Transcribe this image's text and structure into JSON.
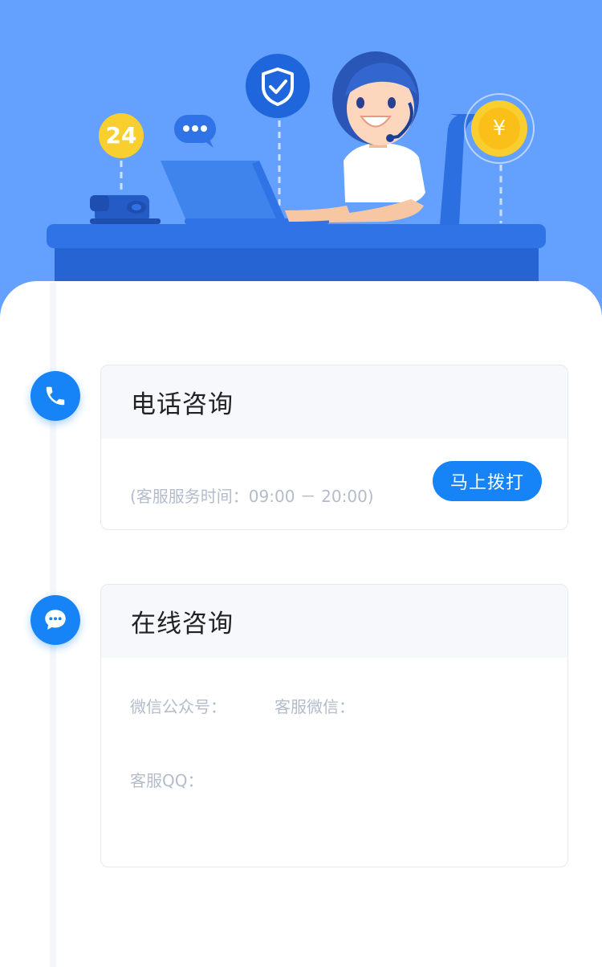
{
  "hero": {
    "badge_24": "24",
    "coin_symbol": "¥",
    "colors": {
      "sky": "#64a0fd",
      "desk": "#2b6fe0",
      "badge": "#f9cf2f"
    }
  },
  "phone": {
    "title": "电话咨询",
    "hours": "(客服服务时间：09:00 － 20:00)",
    "call_label": "马上拨打",
    "icon": "phone-icon"
  },
  "online": {
    "title": "在线咨询",
    "wechat_public_label": "微信公众号：",
    "service_wechat_label": "客服微信：",
    "service_qq_label": "客服QQ：",
    "icon": "chat-icon"
  },
  "colors": {
    "accent": "#1684f6",
    "muted_text": "#b4bccb",
    "title_text": "#222222"
  }
}
